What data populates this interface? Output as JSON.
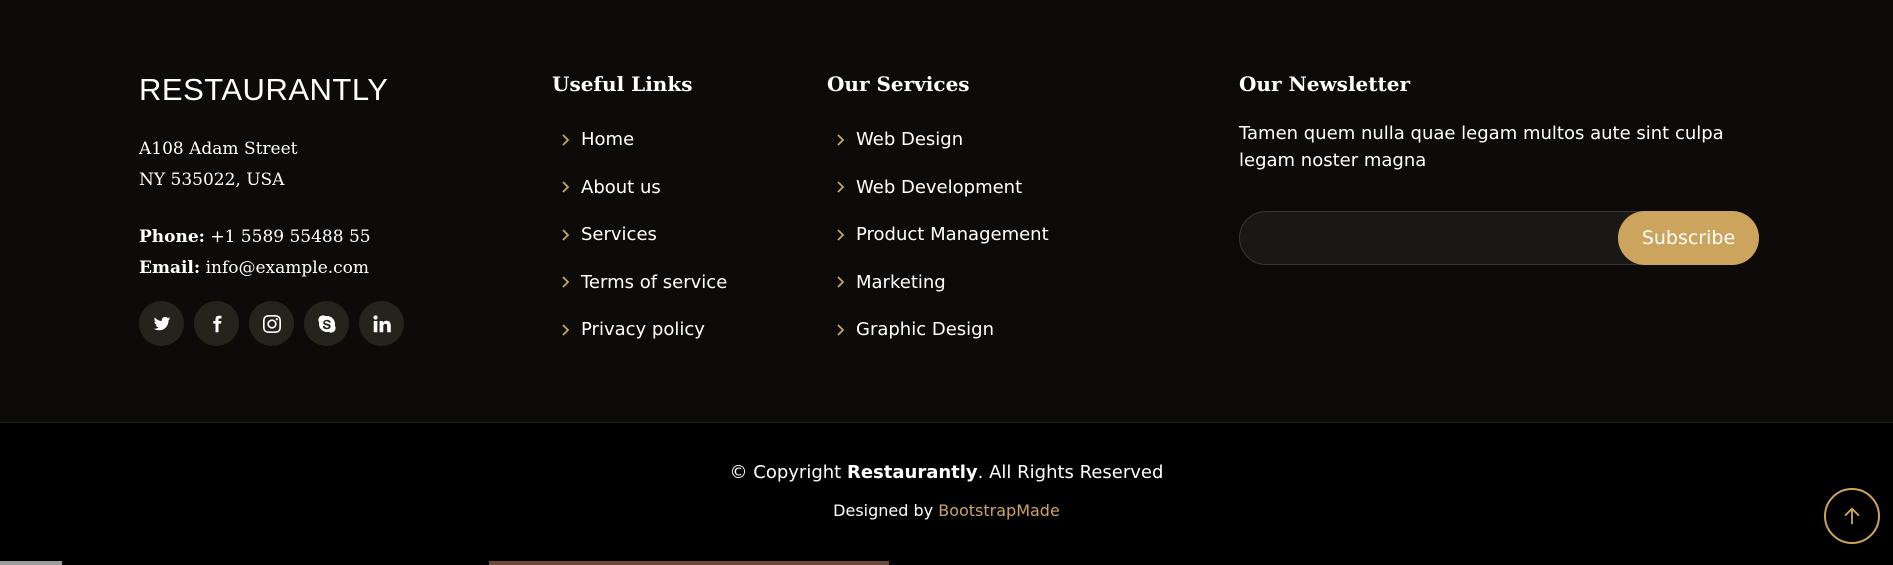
{
  "brand": "RESTAURANTLY",
  "address": {
    "line1": "A108 Adam Street",
    "line2": "NY 535022, USA"
  },
  "contact": {
    "phone_label": "Phone:",
    "phone_value": "+1 5589 55488 55",
    "email_label": "Email:",
    "email_value": "info@example.com"
  },
  "social": [
    {
      "icon": "twitter-icon"
    },
    {
      "icon": "facebook-icon"
    },
    {
      "icon": "instagram-icon"
    },
    {
      "icon": "skype-icon"
    },
    {
      "icon": "linkedin-icon"
    }
  ],
  "useful_links": {
    "heading": "Useful Links",
    "items": [
      "Home",
      "About us",
      "Services",
      "Terms of service",
      "Privacy policy"
    ]
  },
  "services": {
    "heading": "Our Services",
    "items": [
      "Web Design",
      "Web Development",
      "Product Management",
      "Marketing",
      "Graphic Design"
    ]
  },
  "newsletter": {
    "heading": "Our Newsletter",
    "text": "Tamen quem nulla quae legam multos aute sint culpa legam noster magna",
    "input_value": "",
    "subscribe_label": "Subscribe"
  },
  "footer_bottom": {
    "copyright_prefix": "© Copyright",
    "copyright_brand": "Restaurantly",
    "copyright_suffix": ". All Rights Reserved",
    "designed_by": "Designed by",
    "designer": "BootstrapMade"
  },
  "colors": {
    "accent": "#cda45e",
    "footer_top_bg": "#0c0b09",
    "footer_bottom_bg": "#000000",
    "social_bg": "#26231d"
  }
}
